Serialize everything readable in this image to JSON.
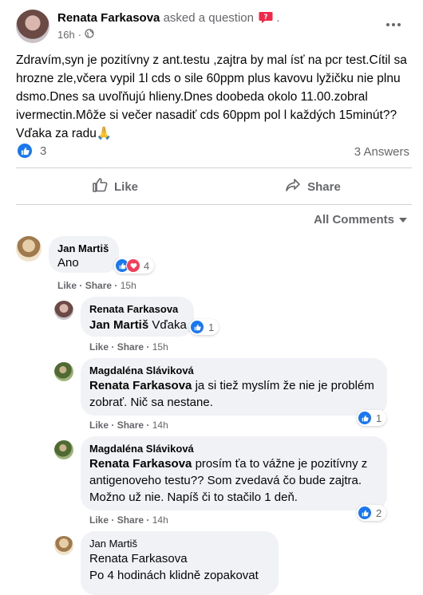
{
  "post": {
    "author": "Renata Farkasova",
    "action": "asked a question",
    "time": "16h",
    "dot": "·",
    "body": "Zdravím,syn je pozitívny z ant.testu ,zajtra by mal ísť na pcr test.Cítil sa hrozne zle,včera vypil 1l cds o sile 60ppm plus kavovu lyžičku nie plnu dsmo.Dnes sa uvoľňujú hlieny.Dnes doobeda okolo 11.00.zobral ivermectin.Môže si večer nasadiť cds 60ppm pol l každých 15minút??Vďaka za radu🙏",
    "reaction_count": "3",
    "answers": "3 Answers",
    "like_label": "Like",
    "share_label": "Share",
    "all_comments": "All Comments"
  },
  "comments": [
    {
      "name": "Jan Martiš",
      "mention": "",
      "text": "Ano",
      "like": "Like",
      "share": "Share",
      "time": "15h",
      "reactions": "4"
    },
    {
      "name": "Renata Farkasova",
      "mention": "Jan Martiš",
      "text": "Vďaka",
      "like": "Like",
      "share": "Share",
      "time": "15h",
      "reactions": "1"
    },
    {
      "name": "Magdaléna Sláviková",
      "mention": "Renata Farkasova",
      "text": "ja si tiež myslím že nie je problém zobrať. Nič sa nestane.",
      "like": "Like",
      "share": "Share",
      "time": "14h",
      "reactions": "1"
    },
    {
      "name": "Magdaléna Sláviková",
      "mention": "Renata Farkasova",
      "text": "prosím ťa to vážne je pozitívny z antigenoveho testu?? Som zvedavá čo bude zajtra. Možno už nie. Napíš či to stačilo 1 deň.",
      "like": "Like",
      "share": "Share",
      "time": "14h",
      "reactions": "2"
    },
    {
      "name": "Jan Martiš",
      "mention": "Renata Farkasova",
      "text": "Po 4 hodinách klidně zopakovat"
    }
  ],
  "colors": {
    "accent": "#1877f2",
    "heart": "#f33e58",
    "question_badge": "#f02849"
  }
}
